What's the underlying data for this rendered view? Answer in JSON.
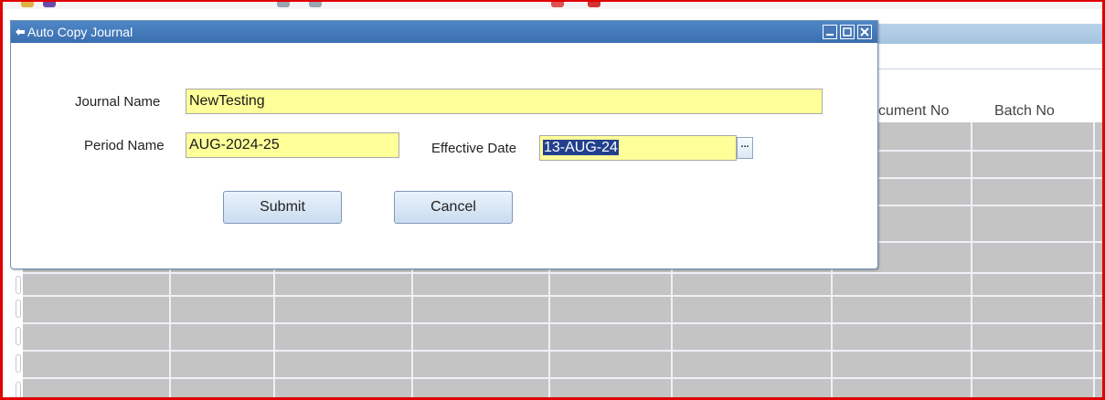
{
  "dialog": {
    "title": "Auto Copy Journal",
    "journal_name": {
      "label": "Journal Name",
      "value": "NewTesting"
    },
    "period_name": {
      "label": "Period Name",
      "value": "AUG-2024-25"
    },
    "effective_date": {
      "label": "Effective Date",
      "value": "13-AUG-24",
      "lov_label": "..."
    },
    "buttons": {
      "submit": "Submit",
      "cancel": "Cancel"
    }
  },
  "background_grid": {
    "columns": [
      "cument No",
      "Batch No"
    ]
  },
  "colors": {
    "titlebar": "#3f79bd",
    "field_required": "#ffff99",
    "grid_cells": "#c4c4c4",
    "frame_highlight": "#e00000",
    "text_selection": "#23408e"
  }
}
